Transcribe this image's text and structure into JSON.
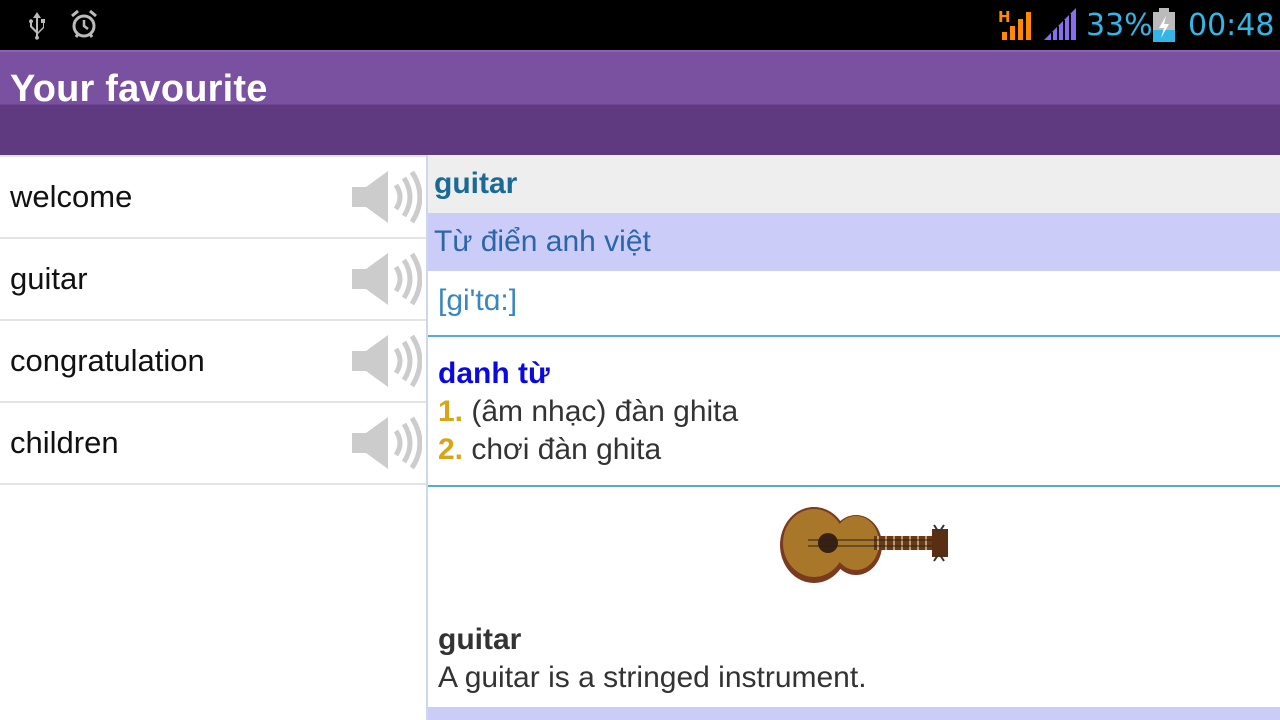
{
  "status_bar": {
    "icons": [
      "usb-icon",
      "alarm-clock-icon",
      "network-h-signal-icon",
      "cell-signal-icon",
      "battery-charging-icon"
    ],
    "battery_percent": "33%",
    "time": "00:48",
    "colors": {
      "accent": "#33b5e5",
      "network": "#ff8a00",
      "signal": "#8a6cf0"
    }
  },
  "action_bar": {
    "title": "Your favourite",
    "color": "#7a50a0"
  },
  "word_list": {
    "items": [
      {
        "label": "welcome",
        "icon": "speaker-icon"
      },
      {
        "label": "guitar",
        "icon": "speaker-icon"
      },
      {
        "label": "congratulation",
        "icon": "speaker-icon"
      },
      {
        "label": "children",
        "icon": "speaker-icon"
      }
    ]
  },
  "detail": {
    "headword": "guitar",
    "dictionary_name": "Từ điển anh việt",
    "phonetic": "[gi'tɑ:]",
    "part_of_speech": "danh từ",
    "senses": [
      {
        "num": "1.",
        "text": "(âm nhạc) đàn ghita"
      },
      {
        "num": "2.",
        "text": "chơi đàn ghita"
      }
    ],
    "image_icon": "guitar-illustration",
    "definition_word": "guitar",
    "definition_text": "A guitar is a stringed instrument."
  }
}
